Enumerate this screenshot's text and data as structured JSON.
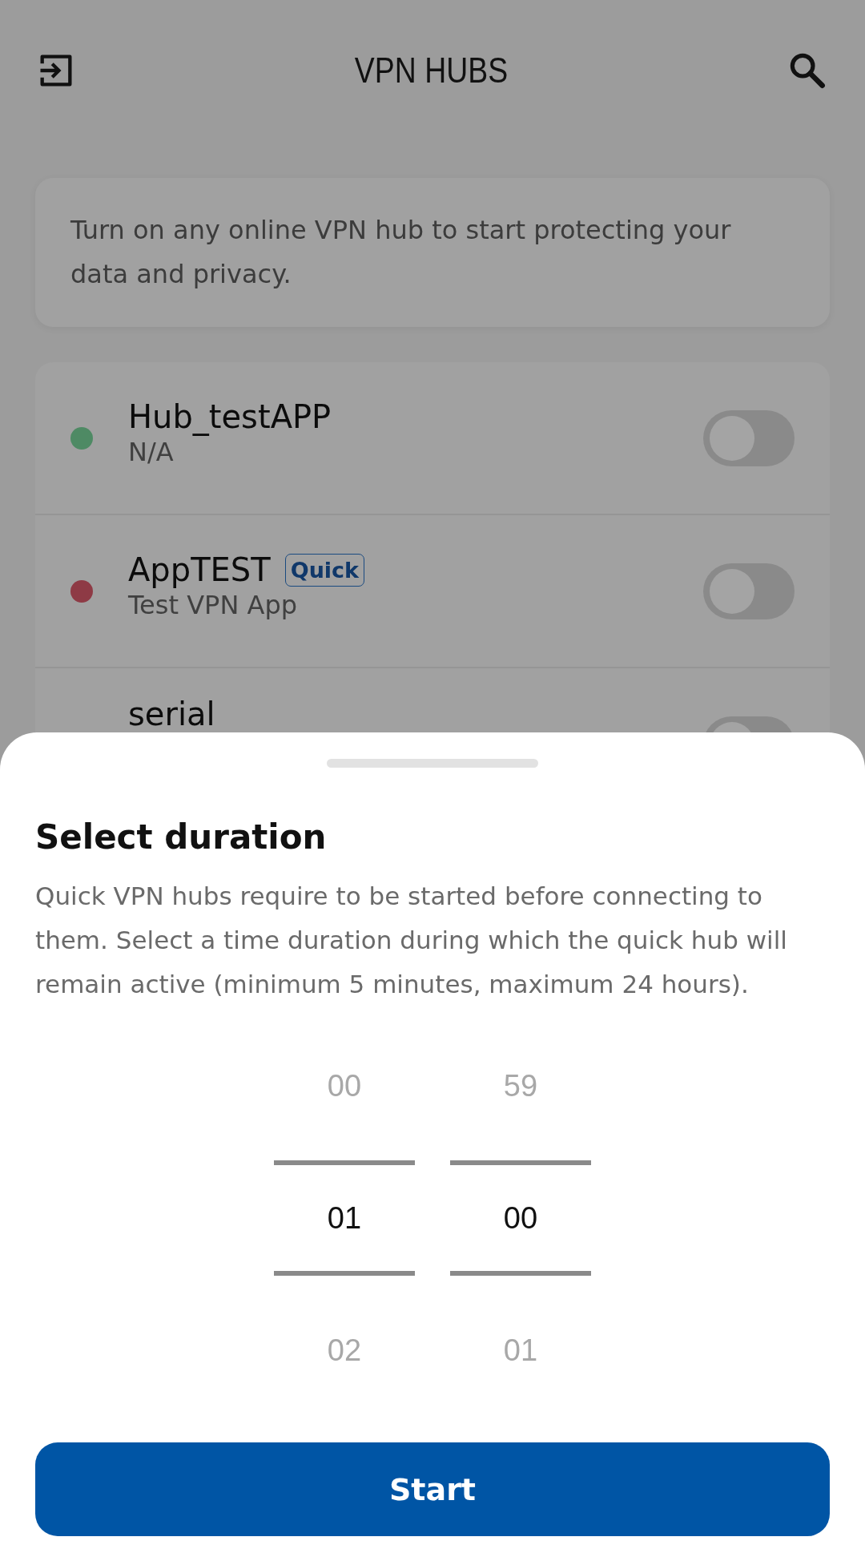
{
  "header": {
    "title": "VPN HUBS"
  },
  "info": {
    "text": "Turn on any online VPN hub to start protecting your data and privacy."
  },
  "hubs": [
    {
      "name": "Hub_testAPP",
      "subtitle": "N/A",
      "color": "#4e8a64",
      "on": false
    },
    {
      "name": "AppTEST",
      "badge": "Quick",
      "subtitle": "Test VPN App",
      "color": "#8e3a45",
      "on": false
    },
    {
      "name": "serial",
      "on": false
    }
  ],
  "sheet": {
    "title": "Select duration",
    "description": "Quick VPN hubs require to be started before connecting to them. Select a time duration during which the quick hub will remain active (minimum 5 minutes, maximum 24 hours).",
    "columns": [
      {
        "items": [
          {
            "value": "00",
            "selected": false
          },
          {
            "value": "01",
            "selected": true
          },
          {
            "value": "02",
            "selected": false
          }
        ]
      },
      {
        "items": [
          {
            "value": "59",
            "selected": false
          },
          {
            "value": "00",
            "selected": true
          },
          {
            "value": "01",
            "selected": false
          }
        ]
      }
    ],
    "button": "Start"
  }
}
